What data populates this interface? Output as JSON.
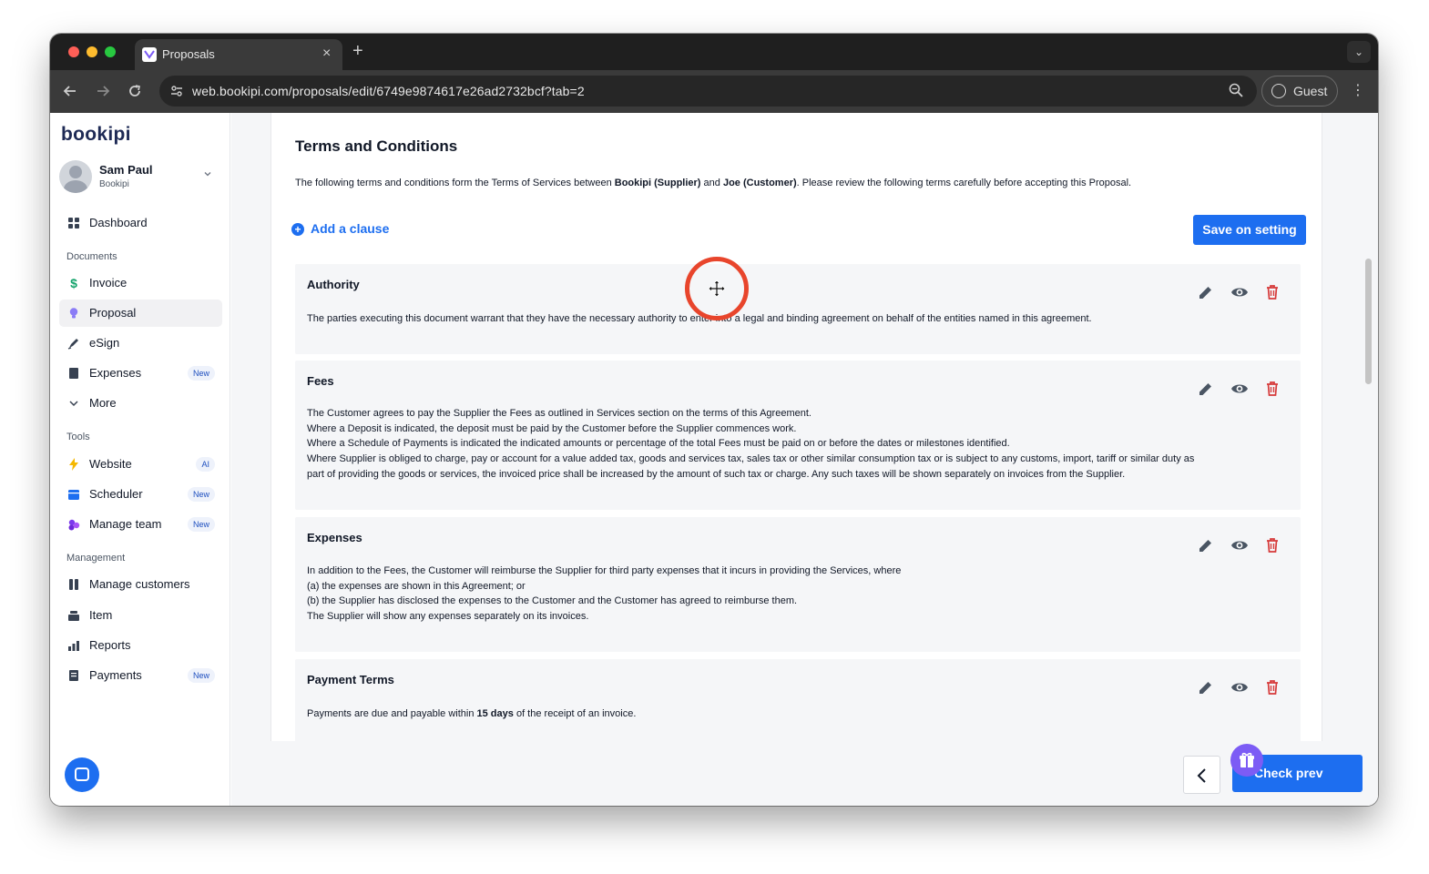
{
  "browser": {
    "tab_title": "Proposals",
    "tab_close": "×",
    "new_tab": "+",
    "tab_menu": "⌄",
    "url": "web.bookipi.com/proposals/edit/6749e9874617e26ad2732bcf?tab=2",
    "profile_label": "Guest",
    "menu": "⋮",
    "traffic_colors": [
      "#ff5f57",
      "#febc2e",
      "#28c840"
    ]
  },
  "sidebar": {
    "logo": "bookipi",
    "user": {
      "name": "Sam Paul",
      "org": "Bookipi"
    },
    "dashboard": "Dashboard",
    "sections": {
      "documents": "Documents",
      "tools": "Tools",
      "management": "Management"
    },
    "documents": [
      {
        "label": "Invoice",
        "icon": "dollar-icon"
      },
      {
        "label": "Proposal",
        "icon": "bulb-icon",
        "active": true
      },
      {
        "label": "eSign",
        "icon": "pen-icon"
      },
      {
        "label": "Expenses",
        "icon": "receipt-icon",
        "badge": "New"
      },
      {
        "label": "More",
        "icon": "chevron-down-icon"
      }
    ],
    "tools": [
      {
        "label": "Website",
        "icon": "bolt-icon",
        "badge": "AI"
      },
      {
        "label": "Scheduler",
        "icon": "calendar-icon",
        "badge": "New"
      },
      {
        "label": "Manage team",
        "icon": "team-icon",
        "badge": "New"
      }
    ],
    "management": [
      {
        "label": "Manage customers",
        "icon": "customers-icon"
      },
      {
        "label": "Item",
        "icon": "item-icon"
      },
      {
        "label": "Reports",
        "icon": "reports-icon"
      },
      {
        "label": "Payments",
        "icon": "payments-icon",
        "badge": "New"
      }
    ]
  },
  "main": {
    "title": "Terms and Conditions",
    "intro": {
      "prefix": "The following terms and conditions form the Terms of Services between ",
      "supplier": "Bookipi (Supplier)",
      "and": " and ",
      "customer": "Joe (Customer)",
      "suffix": ". Please review the following terms carefully before accepting this Proposal."
    },
    "add_clause": "Add a clause",
    "save_button": "Save on setting",
    "clauses": [
      {
        "title": "Authority",
        "lines": [
          "The parties executing this document warrant that they have the necessary authority to enter into a legal and binding agreement on behalf of the entities named in this agreement."
        ]
      },
      {
        "title": "Fees",
        "lines": [
          "The Customer agrees to pay the Supplier the Fees as outlined in Services section on the terms of this Agreement.",
          "Where a Deposit is indicated, the deposit must be paid by the Customer before the Supplier commences work.",
          "Where a Schedule of Payments is indicated the indicated amounts or percentage of the total Fees must be paid on or before the dates or milestones identified.",
          "Where Supplier is obliged to charge, pay or account for a value added tax, goods and services tax, sales tax or other similar consumption tax or is subject to any customs, import, tariff or similar duty as",
          "part of providing the goods or services, the invoiced price shall be increased by the amount of such tax or charge. Any such taxes will be shown separately on invoices from the Supplier."
        ]
      },
      {
        "title": "Expenses",
        "lines": [
          "In addition to the Fees, the Customer will reimburse the Supplier for third party expenses that it incurs in providing the Services, where",
          "(a) the expenses are shown in this Agreement; or",
          "(b) the Supplier has disclosed the expenses to the Customer and the Customer has agreed to reimburse them.",
          "The Supplier will show any expenses separately on its invoices."
        ]
      },
      {
        "title": "Payment Terms",
        "line_prefix": "Payments are due and payable within ",
        "line_bold": "15 days",
        "line_suffix": " of the receipt of an invoice."
      }
    ],
    "check_preview_button": "Check prev"
  },
  "colors": {
    "accent": "#1d6ef0",
    "delete": "#d63a3a",
    "action_icon": "#4a5563",
    "cursor_ring": "#e8452c",
    "gift": "#7c5cf5"
  }
}
